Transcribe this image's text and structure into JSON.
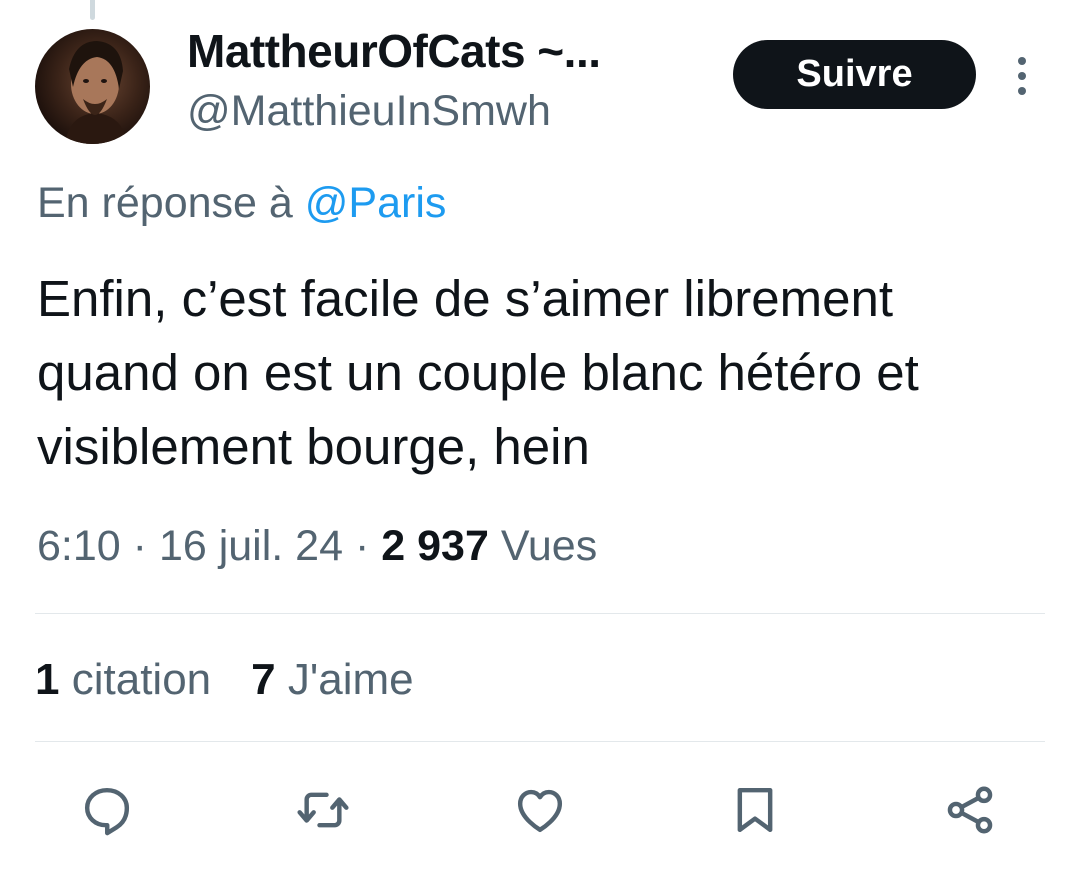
{
  "tweet": {
    "author": {
      "display_name": "MattheurOfCats ~...",
      "handle": "@MatthieuInSmwh"
    },
    "follow_label": "Suivre",
    "reply_prefix": "En réponse à",
    "reply_mention": "@Paris",
    "text": "Enfin, c’est facile de s’aimer librement quand on est un couple blanc hétéro et visiblement bourge, hein",
    "time": "6:10",
    "date": "16 juil. 24",
    "separator": "·",
    "views_count": "2 937",
    "views_label": "Vues"
  },
  "stats": {
    "quotes_count": "1",
    "quotes_label": "citation",
    "likes_count": "7",
    "likes_label": "J'aime"
  },
  "icons": {
    "more": "more-vertical-icon",
    "reply": "reply-icon",
    "retweet": "retweet-icon",
    "like": "heart-icon",
    "bookmark": "bookmark-icon",
    "share": "share-icon"
  },
  "colors": {
    "text": "#0f1419",
    "secondary": "#536471",
    "link": "#1d9bf0",
    "button_bg": "#0f1419"
  }
}
